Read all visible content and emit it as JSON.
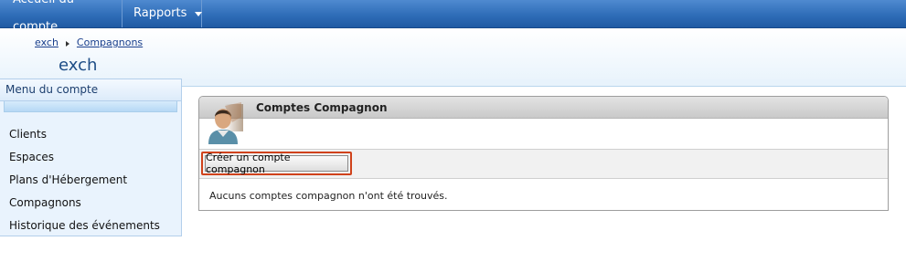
{
  "topnav": {
    "items": [
      {
        "label": "Accueil du compte"
      },
      {
        "label": "Rapports"
      }
    ]
  },
  "breadcrumb": {
    "items": [
      "exch",
      "Compagnons"
    ]
  },
  "header": {
    "title": "exch"
  },
  "sidebar": {
    "title": "Menu du compte",
    "items": [
      {
        "label": "Clients"
      },
      {
        "label": "Espaces"
      },
      {
        "label": "Plans d'Hébergement"
      },
      {
        "label": "Compagnons"
      },
      {
        "label": "Historique des événements"
      }
    ]
  },
  "panel": {
    "title": "Comptes Compagnon",
    "icon": "user-avatar-icon",
    "create_button_label": "Créer un compte compagnon",
    "empty_message": "Aucuns comptes compagnon n'ont été trouvés."
  },
  "colors": {
    "nav_bar": "#2f6db8",
    "highlight_border": "#d0421b",
    "sidebar_bg": "#e9f3fd"
  }
}
